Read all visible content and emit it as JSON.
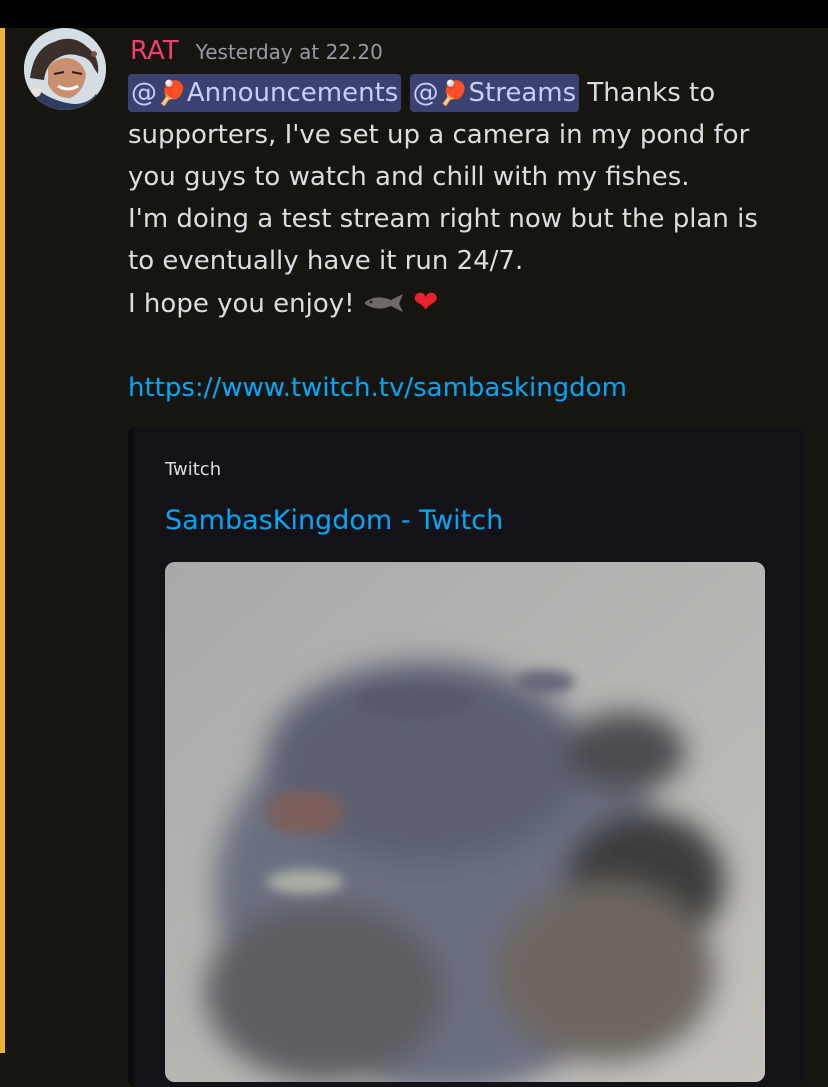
{
  "message": {
    "author": "RAT",
    "timestamp": "Yesterday at 22.20",
    "mentions": [
      {
        "prefix": "@",
        "emoji": "🏓",
        "name": "Announcements"
      },
      {
        "prefix": "@",
        "emoji": "🏓",
        "name": "Streams"
      }
    ],
    "line1_tail": " Thanks to",
    "line2": "supporters, I've set up a camera in my pond for",
    "line3": "you guys to watch and chill with my fishes.",
    "line4": "I'm doing a test stream right now but the plan is",
    "line5": "to eventually have it run 24/7.",
    "line6": "I hope you enjoy!",
    "emoji_fish": "fish-emoji",
    "emoji_heart": "❤",
    "link": "https://www.twitch.tv/sambaskingdom"
  },
  "embed": {
    "provider": "Twitch",
    "title": "SambasKingdom - Twitch",
    "thumbnail": "pond-fish-thumbnail"
  },
  "colors": {
    "background": "#17150f",
    "accent_bar": "#f0b232",
    "username": "#f23f6b",
    "link": "#00a8fc",
    "mention_bg": "#3c4270"
  }
}
